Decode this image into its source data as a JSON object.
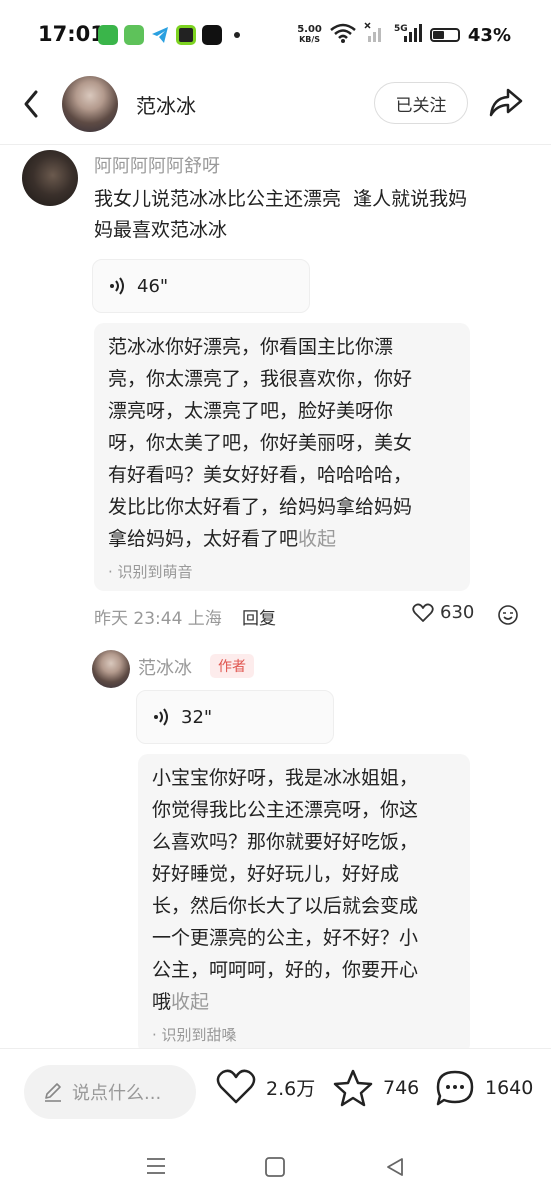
{
  "status": {
    "time": "17:01",
    "net_speed_value": "5.00",
    "net_speed_unit": "KB/S",
    "battery_pct": "43%",
    "battery_level": 0.43
  },
  "header": {
    "name": "范冰冰",
    "follow_label": "已关注"
  },
  "comment": {
    "username": "阿阿阿阿阿舒呀",
    "text": "我女儿说范冰冰比公主还漂亮  逢人就说我妈\n妈最喜欢范冰冰",
    "voice_duration": "46\"",
    "transcript": "范冰冰你好漂亮，你看国主比你漂\n亮，你太漂亮了，我很喜欢你，你好\n漂亮呀，太漂亮了吧，脸好美呀你\n呀，你太美了吧，你好美丽呀，美女\n有好看吗？美女好好看，哈哈哈哈，\n发比比你太好看了，给妈妈拿给妈妈\n拿给妈妈，太好看了吧",
    "collapse_label": "收起",
    "recognized": "· 识别到萌音",
    "meta": "昨天 23:44 上海",
    "reply_label": "回复",
    "likes": "630"
  },
  "reply": {
    "username": "范冰冰",
    "badge": "作者",
    "voice_duration": "32\"",
    "transcript": "小宝宝你好呀，我是冰冰姐姐，\n你觉得我比公主还漂亮呀，你这\n么喜欢吗？那你就要好好吃饭，\n好好睡觉，好好玩儿，好好成\n长，然后你长大了以后就会变成\n一个更漂亮的公主，好不好？小\n公主，呵呵呵，好的，你要开心\n哦",
    "collapse_label": "收起",
    "recognized": "· 识别到甜嗓"
  },
  "bottom": {
    "input_placeholder": "说点什么...",
    "likes": "2.6万",
    "favorites": "746",
    "comments": "1640"
  }
}
